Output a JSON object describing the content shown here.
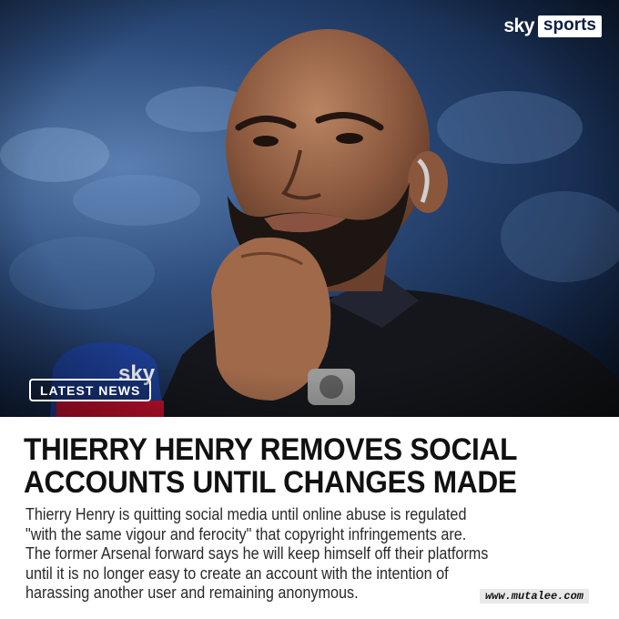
{
  "brand": {
    "logo_text": "sky",
    "logo_badge": "sports"
  },
  "tag": {
    "label": "LATEST NEWS"
  },
  "microphone": {
    "flag_text": "sky"
  },
  "article": {
    "headline_line1": "THIERRY HENRY REMOVES SOCIAL",
    "headline_line2": "ACCOUNTS UNTIL CHANGES MADE",
    "body_lines": [
      "Thierry Henry is quitting social media until online abuse is regulated",
      "\"with the same vigour and ferocity\" that copyright infringements are.",
      "The former Arsenal forward says he will keep himself off their platforms",
      "until it is no longer easy to create an account with the intention of",
      "harassing another user and remaining anonymous."
    ]
  },
  "watermark": {
    "text": "www.mutalee.com"
  },
  "colors": {
    "headline": "#111111",
    "body_text": "#2a2a2a",
    "background": "#ffffff",
    "stadium_blue": "#2d4d7e",
    "jacket": "#15161b"
  }
}
